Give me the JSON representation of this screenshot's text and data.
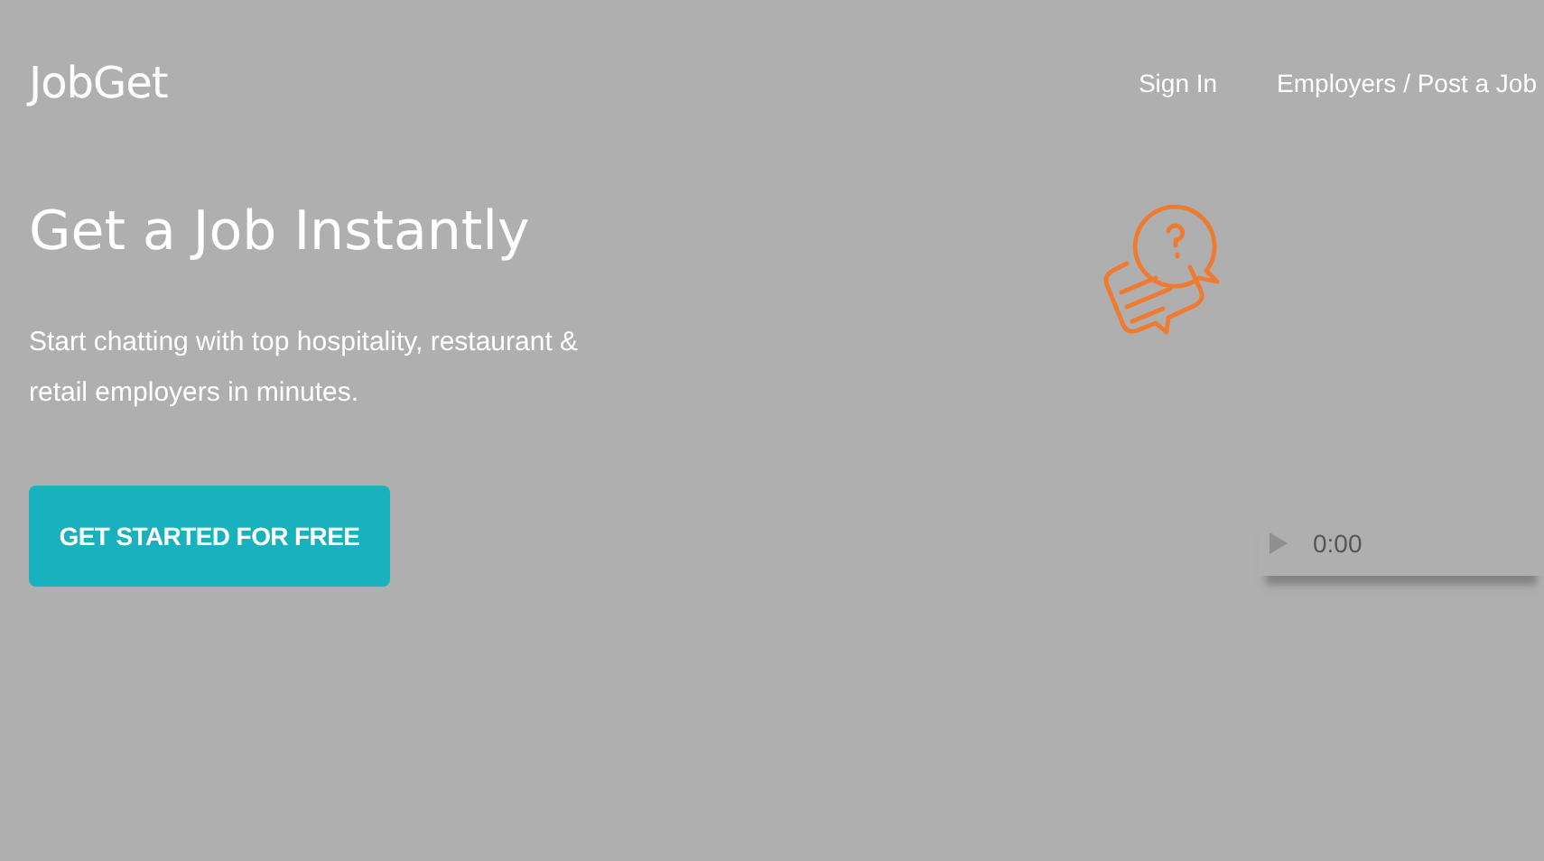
{
  "header": {
    "logo": "JobGet",
    "nav": [
      {
        "label": "Sign In"
      },
      {
        "label": "Employers / Post a Job"
      }
    ]
  },
  "hero": {
    "title": "Get a Job Instantly",
    "text": "Start chatting with top hospitality, restaurant & retail employers in minutes.",
    "button": "GET STARTED FOR FREE"
  },
  "player": {
    "time": "0:00"
  }
}
